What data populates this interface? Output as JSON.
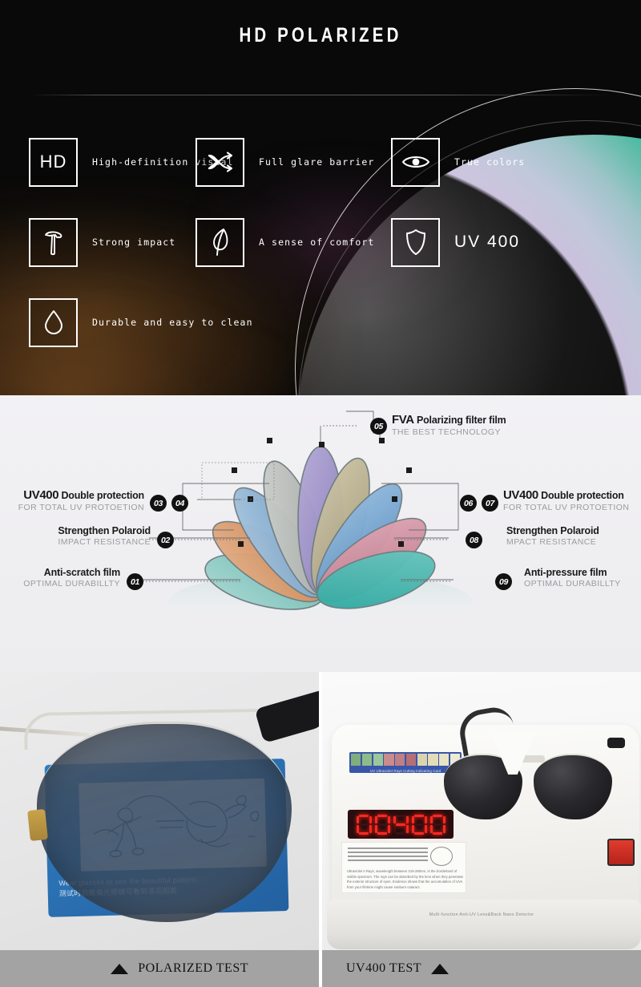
{
  "hero": {
    "title": "HD POLARIZED",
    "features": [
      {
        "icon": "hd-icon",
        "icon_text": "HD",
        "label": "High-definition visual"
      },
      {
        "icon": "shuffle-icon",
        "icon_text": "",
        "label": "Full glare barrier"
      },
      {
        "icon": "eye-icon",
        "icon_text": "",
        "label": "True colors"
      },
      {
        "icon": "hammer-icon",
        "icon_text": "",
        "label": "Strong impact"
      },
      {
        "icon": "leaf-icon",
        "icon_text": "",
        "label": "A sense of comfort"
      },
      {
        "icon": "shield-icon",
        "icon_text": "",
        "label": "UV 400"
      },
      {
        "icon": "droplet-icon",
        "icon_text": "",
        "label": "Durable and easy to clean"
      }
    ]
  },
  "diagram": {
    "labels": [
      {
        "num": "05",
        "title_strong": "FVA",
        "title": "Polarizing filter film",
        "subtitle": "THE BEST TECHNOLOGY"
      },
      {
        "num": "03",
        "num2": "04",
        "title_strong": "UV400",
        "title": "Double protection",
        "subtitle": "FOR TOTAL UV PROTOETION"
      },
      {
        "num": "02",
        "title_strong": "",
        "title": "Strengthen Polaroid",
        "subtitle": "IMPACT RESISTANCE"
      },
      {
        "num": "01",
        "title_strong": "",
        "title": "Anti-scratch film",
        "subtitle": "OPTIMAL DURABILLTY"
      },
      {
        "num": "06",
        "num2": "07",
        "title_strong": "UV400",
        "title": "Double protection",
        "subtitle": "FOR TOTAL UV PROTOETION"
      },
      {
        "num": "08",
        "title_strong": "",
        "title": "Strengthen Polaroid",
        "subtitle": "MPACT RESISTANCE"
      },
      {
        "num": "09",
        "title_strong": "",
        "title": "Anti-pressure film",
        "subtitle": "OPTIMAL DURABILLTY"
      }
    ],
    "petal_colors": [
      "#7fc3bd",
      "#d89a6a",
      "#7fa9cf",
      "#b9bcb8",
      "#9b8fc4",
      "#b9b091",
      "#6f9fd0",
      "#cf8fa0",
      "#3fb5ad"
    ]
  },
  "photos": {
    "left": {
      "card_caption_en": "Wear glasses to see the beautiful pattern",
      "card_caption_cn": "测试时佩戴偏光眼镜可看到漂亮图案",
      "caption": "POLARIZED TEST"
    },
    "right": {
      "display_value": "00400",
      "strip_label": "UV Ultraviolet Rays Cutting Indicating Card",
      "info_text": "Ultraviolet A Rays, wavelength between 315-280nm, is the borderland of visible spectrum. The rays can be absorbed by the lens when they penetrate the exterior structure of eyes. Evidence shows that the accumulation of UVA from your lifetime might cause sunburn cataract.",
      "foot_label": "Multi-function Anti-UV Lens&Back Nano Detector",
      "caption": "UV400 TEST"
    }
  },
  "colors": {
    "hero_bg": "#090909",
    "diagram_bg": "#f0eff2",
    "caption_bar": "#a3a3a3",
    "badge": "#111111"
  }
}
